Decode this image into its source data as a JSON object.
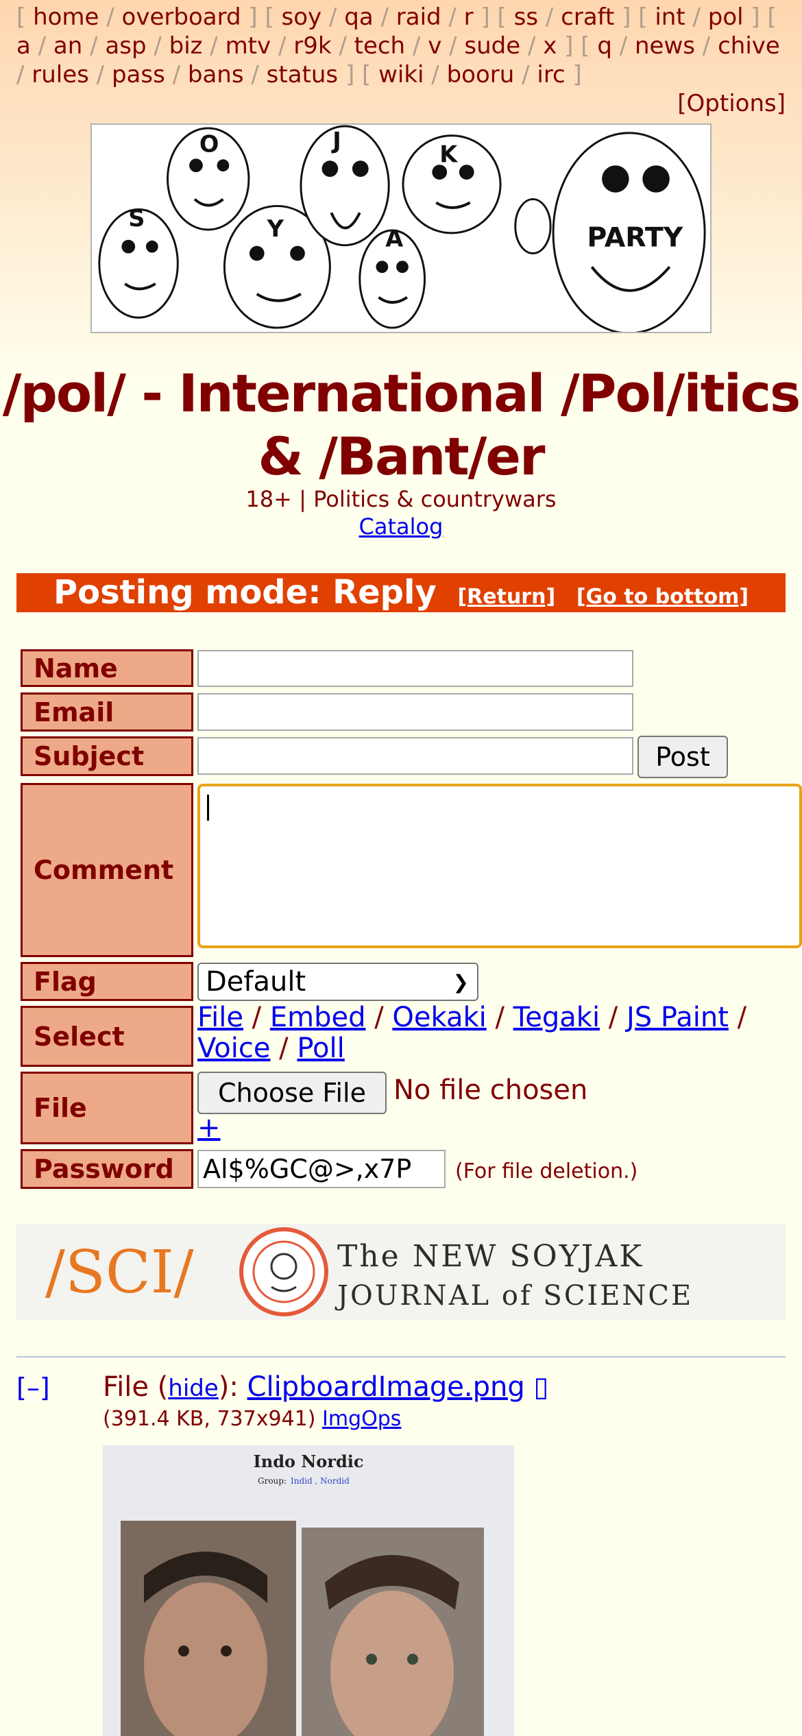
{
  "boardlist": {
    "groups": [
      [
        "home",
        "overboard"
      ],
      [
        "soy",
        "qa",
        "raid",
        "r"
      ],
      [
        "ss",
        "craft"
      ],
      [
        "int",
        "pol"
      ],
      [
        "a",
        "an",
        "asp",
        "biz",
        "mtv",
        "r9k",
        "tech",
        "v",
        "sude",
        "x"
      ],
      [
        "q",
        "news",
        "chive",
        "rules",
        "pass",
        "bans",
        "status"
      ],
      [
        "wiki",
        "booru",
        "irc"
      ]
    ],
    "options_label": "[Options]"
  },
  "banner": {
    "faces": [
      "S",
      "O",
      "Y",
      "J",
      "A",
      "K"
    ],
    "party_text": "PARTY"
  },
  "board": {
    "title_line1": "/pol/ - International /Pol/itics",
    "title_line2": "& /Bant/er",
    "subtitle": "18+ | Politics & countrywars",
    "catalog_label": "Catalog"
  },
  "posting_mode": {
    "label": "Posting mode: Reply",
    "return_label": "[Return]",
    "bottom_label": "[Go to bottom]"
  },
  "form": {
    "name_label": "Name",
    "email_label": "Email",
    "subject_label": "Subject",
    "post_button": "Post",
    "comment_label": "Comment",
    "flag_label": "Flag",
    "flag_value": "Default",
    "select_label": "Select",
    "select_options": [
      "File",
      "Embed",
      "Oekaki",
      "Tegaki",
      "JS Paint",
      "Voice",
      "Poll"
    ],
    "file_label": "File",
    "choose_file_button": "Choose File",
    "no_file_text": "No file chosen",
    "add_file": "+",
    "password_label": "Password",
    "password_value": "Al$%GC@>,x7P",
    "password_note": "(For file deletion.)"
  },
  "ad": {
    "left_text": "/SCI/",
    "line1": "The NEW SOYJAK",
    "line2": "JOURNAL of SCIENCE"
  },
  "post": {
    "collapse": "[–]",
    "file_prefix": "File (",
    "hide_label": "hide",
    "file_mid": "): ",
    "filename": "ClipboardImage.png",
    "meta": "(391.4 KB, 737x941)",
    "imgops": "ImgOps",
    "image_title": "Indo Nordic",
    "image_group_prefix": "Group:",
    "image_group_links": "Indid , Nordid"
  },
  "colors": {
    "accent": "#800000",
    "postmode_bg": "#e04000",
    "label_bg": "#eeaa88",
    "link": "#0000ee",
    "focus_border": "#e8a317"
  }
}
